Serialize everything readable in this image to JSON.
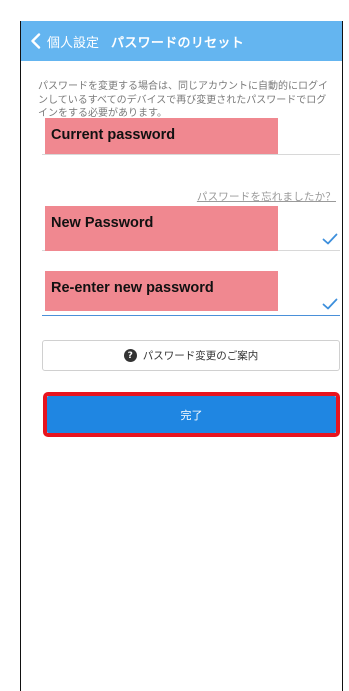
{
  "header": {
    "back_label": "個人設定",
    "title": "パスワードのリセット",
    "color": "#64b5f0"
  },
  "description": "パスワードを変更する場合は、同じアカウントに自動的にログインしているすべてのデバイスで再び変更されたパスワードでログインをする必要があります。",
  "fields": {
    "current": {
      "label": "Current password",
      "valid": false
    },
    "new": {
      "label": "New Password",
      "valid": true
    },
    "reenter": {
      "label": "Re-enter new password",
      "valid": true
    }
  },
  "forgot_link": "パスワードを忘れましたか？",
  "guide_button": {
    "icon": "help-icon",
    "label": "パスワード変更のご案内"
  },
  "done_button": {
    "label": "完了",
    "color": "#1f86e2",
    "highlight_color": "#e8141e"
  }
}
